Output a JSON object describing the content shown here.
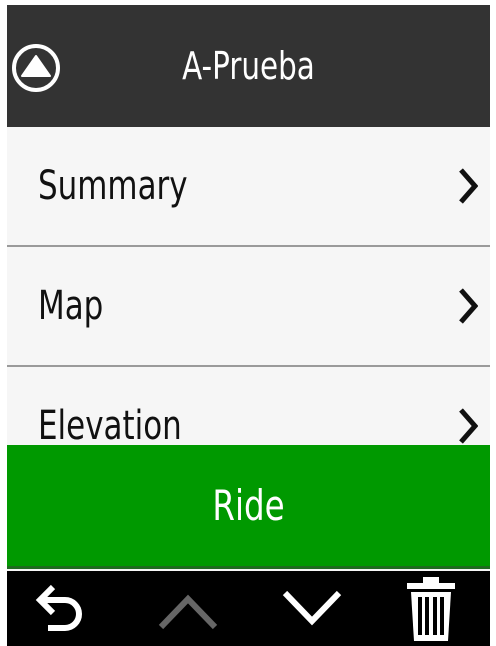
{
  "header": {
    "title": "A-Prueba",
    "up_icon": "circle-up-arrow-icon"
  },
  "menu": {
    "items": [
      {
        "label": "Summary",
        "icon": "chevron-right-icon"
      },
      {
        "label": "Map",
        "icon": "chevron-right-icon"
      },
      {
        "label": "Elevation",
        "icon": "chevron-right-icon"
      }
    ]
  },
  "action": {
    "label": "Ride",
    "color": "#009900"
  },
  "toolbar": {
    "buttons": [
      {
        "icon": "back-arrow-icon",
        "state": "enabled"
      },
      {
        "icon": "chevron-up-icon",
        "state": "disabled"
      },
      {
        "icon": "chevron-down-icon",
        "state": "enabled"
      },
      {
        "icon": "trash-icon",
        "state": "enabled"
      }
    ]
  },
  "colors": {
    "header_bg": "#333333",
    "list_bg": "#f6f6f6",
    "action_bg": "#009900",
    "toolbar_bg": "#000000",
    "disabled_icon": "#666666"
  }
}
